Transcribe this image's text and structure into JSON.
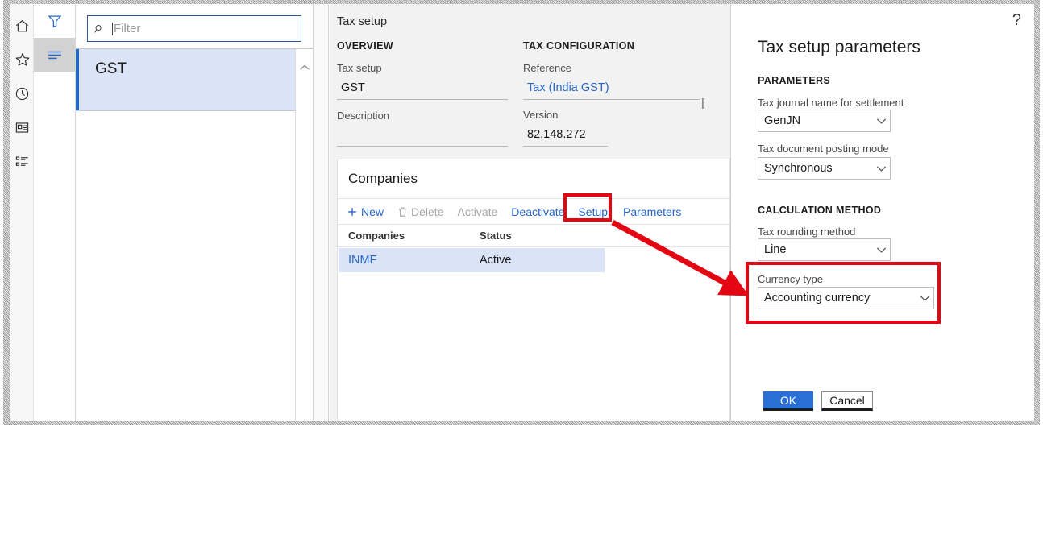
{
  "nav_rail": {
    "items": [
      {
        "name": "home-icon",
        "label": "Home"
      },
      {
        "name": "star-icon",
        "label": "Favorites"
      },
      {
        "name": "clock-icon",
        "label": "Recent"
      },
      {
        "name": "workspace-icon",
        "label": "Workspaces"
      },
      {
        "name": "modules-icon",
        "label": "Modules"
      }
    ]
  },
  "tool_rail": {
    "filter_label": "Filter pane",
    "list_label": "List pane"
  },
  "list_pane": {
    "search": {
      "placeholder": "Filter",
      "value": ""
    },
    "items": [
      {
        "label": "GST",
        "selected": true
      }
    ]
  },
  "detail": {
    "breadcrumb": "Tax setup",
    "overview": {
      "heading": "OVERVIEW",
      "fields": [
        {
          "label": "Tax setup",
          "value": "GST"
        },
        {
          "label": "Description",
          "value": ""
        }
      ]
    },
    "tax_configuration": {
      "heading": "TAX CONFIGURATION",
      "fields": [
        {
          "label": "Reference",
          "value": "Tax (India GST)",
          "is_link": true
        },
        {
          "label": "Version",
          "value": "82.148.272",
          "is_link": false
        }
      ]
    },
    "companies_card": {
      "title": "Companies",
      "toolbar": [
        {
          "label": "New",
          "icon": "plus-icon",
          "disabled": false
        },
        {
          "label": "Delete",
          "icon": "trash-icon",
          "disabled": true
        },
        {
          "label": "Activate",
          "icon": "",
          "disabled": true
        },
        {
          "label": "Deactivate",
          "icon": "",
          "disabled": false
        },
        {
          "label": "Setup",
          "icon": "",
          "disabled": false
        },
        {
          "label": "Parameters",
          "icon": "",
          "disabled": false
        }
      ],
      "columns": [
        "Companies",
        "Status"
      ],
      "rows": [
        {
          "company": "INMF",
          "status": "Active",
          "selected": true
        }
      ]
    }
  },
  "dialog": {
    "help_glyph": "?",
    "title": "Tax setup parameters",
    "sections": [
      {
        "heading": "PARAMETERS",
        "fields": [
          {
            "label": "Tax journal name for settlement",
            "value": "GenJN"
          },
          {
            "label": "Tax document posting mode",
            "value": "Synchronous"
          }
        ]
      },
      {
        "heading": "CALCULATION METHOD",
        "fields": [
          {
            "label": "Tax rounding method",
            "value": "Line"
          },
          {
            "label": "Currency type",
            "value": "Accounting currency"
          }
        ]
      }
    ],
    "ok_label": "OK",
    "cancel_label": "Cancel"
  },
  "annotations": {
    "accent_color": "#e30613",
    "highlighted": [
      "Setup",
      "Currency type"
    ]
  },
  "colors": {
    "link_blue": "#2566c9",
    "selection_blue": "#dbe4f7",
    "accent_bar": "#1f69c9",
    "primary_button": "#2a6fd6",
    "annotation_red": "#e30613"
  }
}
